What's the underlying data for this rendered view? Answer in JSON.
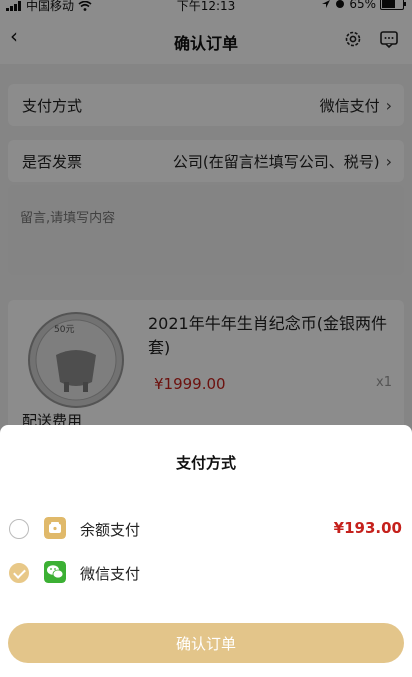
{
  "status_bar": {
    "carrier": "中国移动",
    "time": "下午12:13",
    "battery": "65%",
    "battery_level": 0.65
  },
  "nav": {
    "title": "确认订单"
  },
  "payment_row": {
    "label": "支付方式",
    "value": "微信支付"
  },
  "invoice_row": {
    "label": "是否发票",
    "value": "公司(在留言栏填写公司、税号)"
  },
  "remark": {
    "placeholder": "留言,请填写内容"
  },
  "product": {
    "coin_face": "50元",
    "name": "2021年牛年生肖纪念币(金银两件套)",
    "price": "¥1999.00",
    "qty": "x1",
    "next_row_label": "配送费用"
  },
  "sheet": {
    "title": "支付方式",
    "options": [
      {
        "label": "余额支付",
        "amount": "¥193.00",
        "selected": false,
        "icon": "wallet-icon",
        "color": "#e0b96a"
      },
      {
        "label": "微信支付",
        "amount": "",
        "selected": true,
        "icon": "wechat-icon",
        "color": "#3cb034"
      }
    ],
    "confirm_label": "确认订单"
  },
  "colors": {
    "accent": "#e3c58a",
    "price": "#c5211c"
  }
}
